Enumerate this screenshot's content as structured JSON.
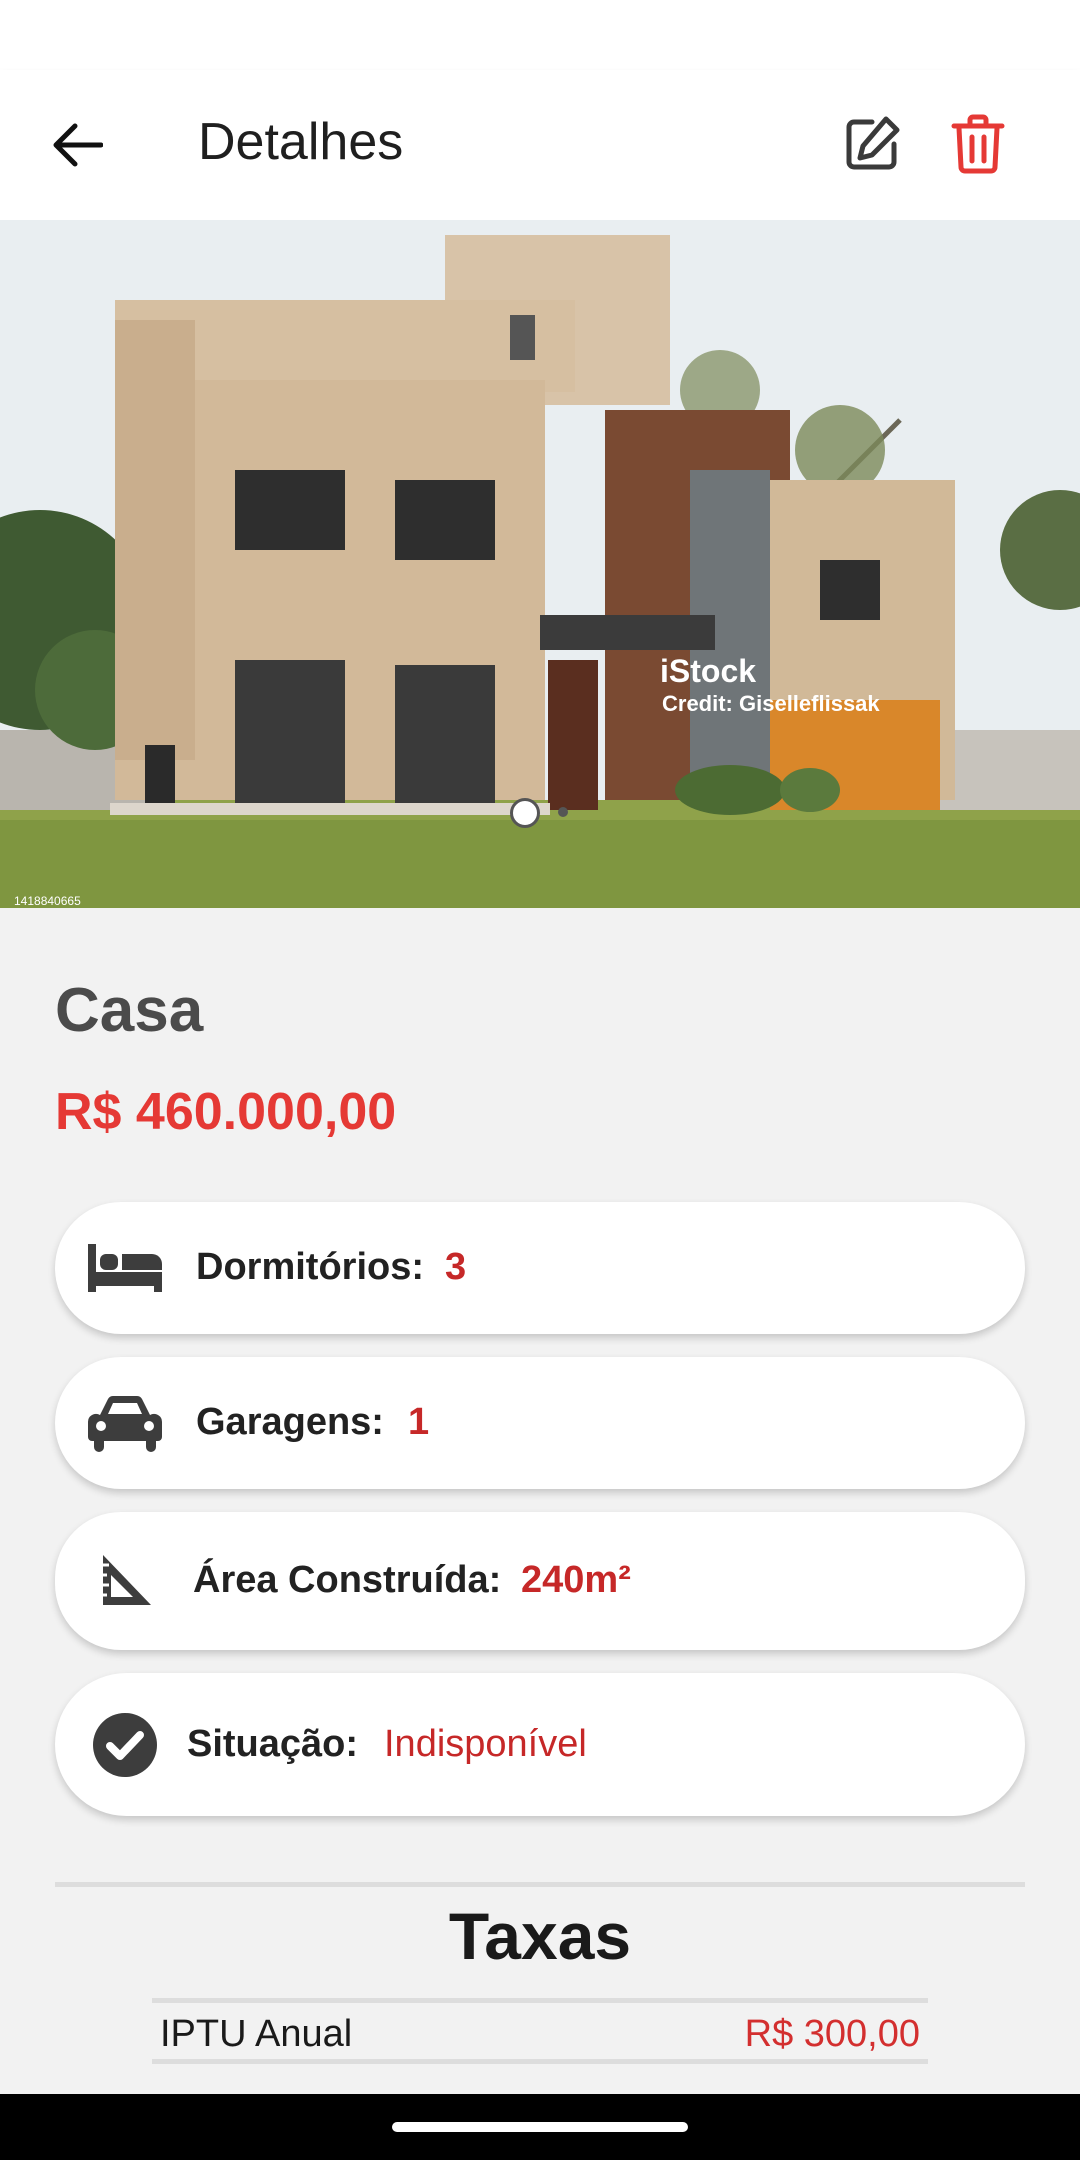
{
  "app_bar": {
    "title": "Detalhes",
    "back_icon": "arrow-left-icon",
    "edit_icon": "pencil-square-icon",
    "delete_icon": "trash-icon",
    "delete_color": "#e53935"
  },
  "gallery": {
    "watermark_brand": "iStock",
    "watermark_credit": "Credit: Giselleflissak",
    "image_id": "1418840665",
    "page_count": 2,
    "active_page": 1
  },
  "property": {
    "title": "Casa",
    "price": "R$ 460.000,00"
  },
  "features": [
    {
      "icon": "bed-icon",
      "label": "Dormitórios:",
      "value": "3"
    },
    {
      "icon": "car-icon",
      "label": "Garagens:",
      "value": "1"
    },
    {
      "icon": "set-square-icon",
      "label": "Área Construída:",
      "value": "240m²"
    },
    {
      "icon": "check-circle-icon",
      "label": "Situação:",
      "value": "Indisponível"
    }
  ],
  "fees": {
    "title": "Taxas",
    "rows": [
      {
        "label": "IPTU Anual",
        "value": "R$ 300,00"
      }
    ]
  },
  "colors": {
    "accent": "#e53935",
    "value_red": "#c62828",
    "background": "#f2f2f2"
  }
}
